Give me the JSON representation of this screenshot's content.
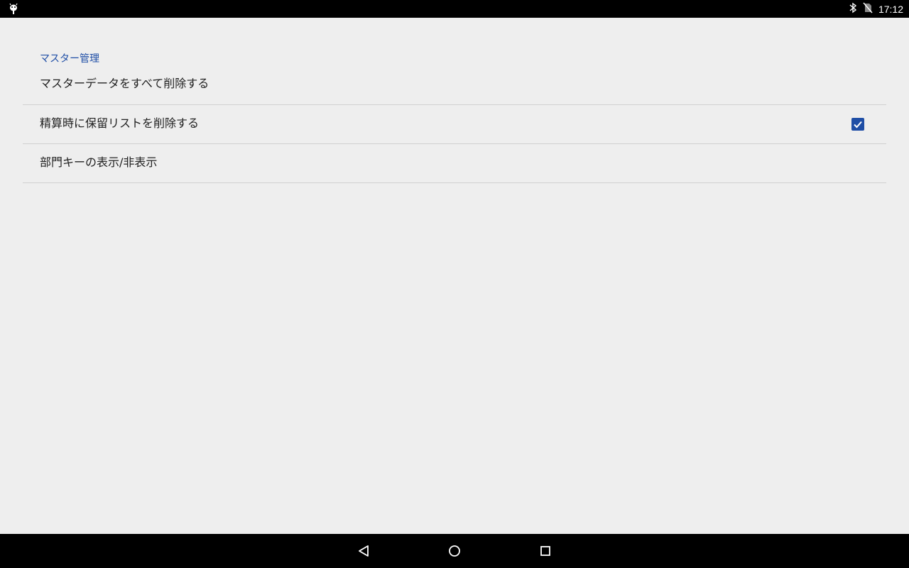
{
  "status_bar": {
    "time": "17:12",
    "icons": [
      "android-debug-icon",
      "bluetooth-icon",
      "no-sim-icon"
    ]
  },
  "preferences": {
    "category_title": "マスター管理",
    "items": [
      {
        "label": "マスターデータをすべて削除する"
      },
      {
        "label": "精算時に保留リストを削除する",
        "checked": true
      },
      {
        "label": "部門キーの表示/非表示"
      }
    ]
  },
  "nav_bar": {
    "buttons": [
      "back-icon",
      "home-icon",
      "recents-icon"
    ]
  },
  "colors": {
    "accent": "#1f4ea6",
    "background": "#eeeeee",
    "bars": "#000000"
  }
}
